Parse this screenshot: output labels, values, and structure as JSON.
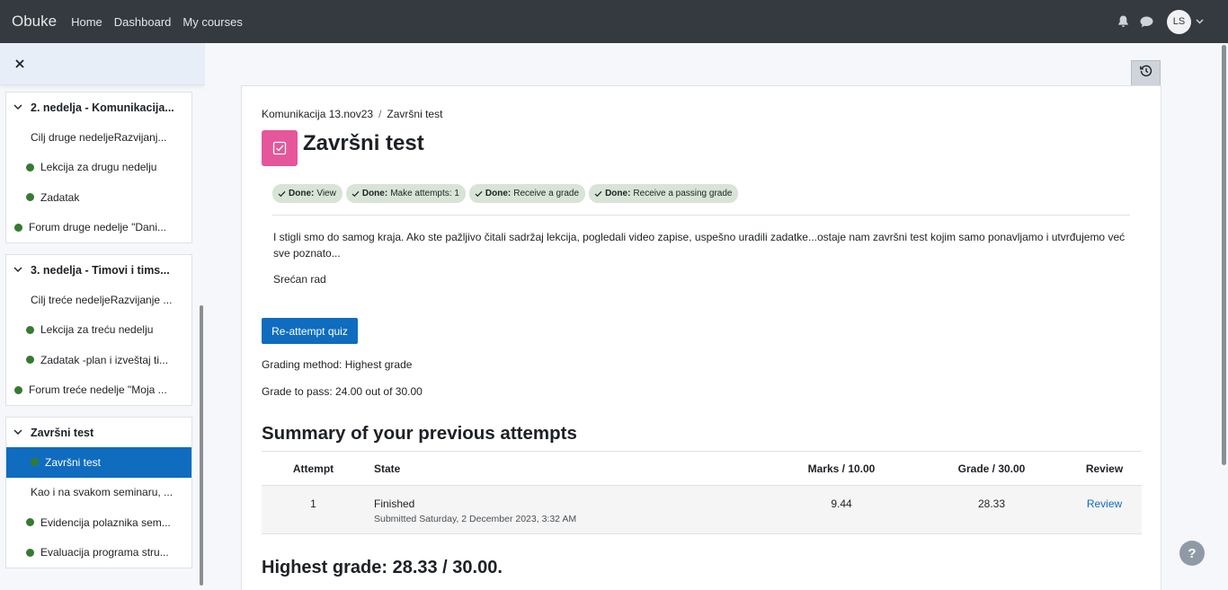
{
  "navbar": {
    "brand": "Obuke",
    "links": [
      "Home",
      "Dashboard",
      "My courses"
    ],
    "avatar_initials": "LS"
  },
  "drawer": {
    "sections": [
      {
        "title": "2. nedelja - Komunikacija...",
        "items": [
          {
            "label": "Cilj druge nedeljeRazvijanj...",
            "dot": false,
            "level": 1
          },
          {
            "label": "Lekcija za drugu nedelju",
            "dot": true,
            "level": 2
          },
          {
            "label": "Zadatak",
            "dot": true,
            "level": 2
          },
          {
            "label": "Forum druge nedelje \"Dani...",
            "dot": true,
            "level": 0
          }
        ]
      },
      {
        "title": "3. nedelja - Timovi i tims...",
        "items": [
          {
            "label": "Cilj treće nedeljeRazvijanje ...",
            "dot": false,
            "level": 1
          },
          {
            "label": "Lekcija za treću nedelju",
            "dot": true,
            "level": 2
          },
          {
            "label": "Zadatak -plan i izveštaj ti...",
            "dot": true,
            "level": 2
          },
          {
            "label": "Forum treće nedelje \"Moja ...",
            "dot": true,
            "level": 0
          }
        ]
      },
      {
        "title": "Završni test",
        "items": [
          {
            "label": "Završni test",
            "dot": true,
            "level": 1,
            "active": true
          },
          {
            "label": "Kao i na svakom seminaru, ...",
            "dot": false,
            "level": 1
          },
          {
            "label": "Evidencija polaznika sem...",
            "dot": true,
            "level": 2
          },
          {
            "label": "Evaluacija programa stru...",
            "dot": true,
            "level": 2
          }
        ]
      }
    ]
  },
  "breadcrumb": [
    "Komunikacija 13.nov23",
    "Završni test"
  ],
  "page_title": "Završni test",
  "completion": [
    {
      "done": "Done:",
      "label": "View"
    },
    {
      "done": "Done:",
      "label": "Make attempts: 1"
    },
    {
      "done": "Done:",
      "label": "Receive a grade"
    },
    {
      "done": "Done:",
      "label": "Receive a passing grade"
    }
  ],
  "intro": {
    "paragraph": "I stigli smo do samog kraja. Ako ste pažljivo čitali sadržaj lekcija, pogledali video zapise, uspešno uradili zadatke...ostaje nam završni test kojim samo ponavljamo i utvrđujemo već sve poznato...",
    "closing": "Srećan rad"
  },
  "reattempt_label": "Re-attempt quiz",
  "grading_method": "Grading method: Highest grade",
  "grade_to_pass": "Grade to pass: 24.00 out of 30.00",
  "summary_heading": "Summary of your previous attempts",
  "table": {
    "headers": {
      "attempt": "Attempt",
      "state": "State",
      "marks": "Marks / 10.00",
      "grade": "Grade / 30.00",
      "review": "Review"
    },
    "rows": [
      {
        "attempt": "1",
        "state": "Finished",
        "submitted": "Submitted Saturday, 2 December 2023, 3:32 AM",
        "marks": "9.44",
        "grade": "28.33",
        "review": "Review"
      }
    ]
  },
  "highest_grade": "Highest grade: 28.33 / 30.00.",
  "help_label": "?"
}
